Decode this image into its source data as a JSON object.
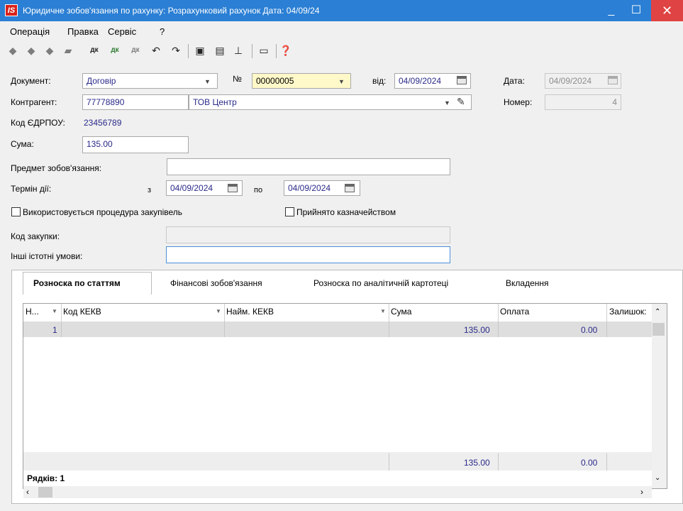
{
  "window": {
    "logo": "IS",
    "title": "Юридичне зобов'язання по рахунку: Розрахунковий рахунок Дата: 04/09/24",
    "minimize_label": "_",
    "maximize_label": "☐",
    "close_label": "✕"
  },
  "menu": [
    "Операція",
    "Правка",
    "Сервіс",
    "?"
  ],
  "toolbar": {
    "icons": [
      "arrow-back-icon",
      "arrow-left-icon",
      "arrow-right-icon",
      "forward-icon",
      "dk-icon",
      "dk-green-icon",
      "dk-gray-icon",
      "undo-icon",
      "undo2-icon",
      "save-icon",
      "document-icon",
      "tree-icon",
      "panel-icon",
      "help-icon"
    ]
  },
  "form": {
    "document_label": "Документ:",
    "document_value": "Договір",
    "number_label": "№",
    "number_value": "00000005",
    "from_label": "від:",
    "from_value": "04/09/2024",
    "date_label": "Дата:",
    "date_value": "04/09/2024",
    "counterparty_label": "Контрагент:",
    "counterparty_code": "77778890",
    "counterparty_name": "ТОВ Центр",
    "num_label": "Номер:",
    "num_value": "4",
    "edrpou_label": "Код ЄДРПОУ:",
    "edrpou_value": "23456789",
    "sum_label": "Сума:",
    "sum_value": "135.00",
    "subject_label": "Предмет зобов'язання:",
    "subject_value": "",
    "term_label": "Термін дії:",
    "term_from_label": "з",
    "term_from_value": "04/09/2024",
    "term_to_label": "по",
    "term_to_value": "04/09/2024",
    "procurement_check_label": "Використовується процедура закупівель",
    "treasury_check_label": "Прийнято казначейством",
    "purchase_code_label": "Код закупки:",
    "purchase_code_value": "",
    "other_terms_label": "Інші істотні умови:",
    "other_terms_value": ""
  },
  "tabs": [
    "Розноска по статтям",
    "Фінансові зобов'язання",
    "Розноска по аналітичній картотеці",
    "Вкладення"
  ],
  "grid": {
    "columns": [
      "Н...",
      "Код КЕКВ",
      "Найм. КЕКВ",
      "Сума",
      "Оплата",
      "Залишок:"
    ],
    "rows": [
      {
        "n": "1",
        "code": "",
        "name": "",
        "sum": "135.00",
        "payment": "0.00",
        "rest": ""
      }
    ],
    "footer": {
      "sum": "135.00",
      "payment": "0.00"
    },
    "rows_count_label": "Рядків: 1"
  }
}
